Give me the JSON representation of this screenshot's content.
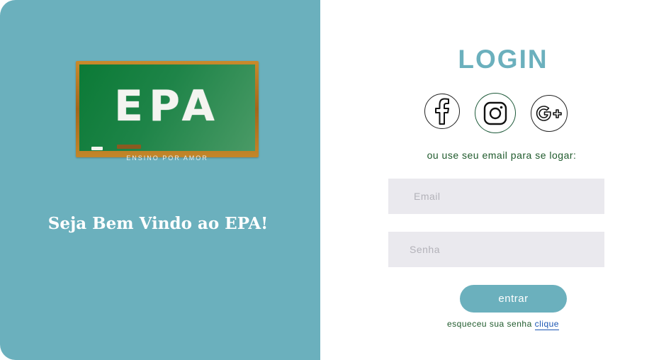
{
  "left": {
    "board_text": "EPA",
    "board_subtitle": "ENSINO POR AMOR",
    "welcome": "Seja Bem Vindo ao EPA!"
  },
  "login": {
    "title": "LOGIN",
    "social_icons": [
      "facebook-icon",
      "instagram-icon",
      "google-plus-icon"
    ],
    "alt_text": "ou use seu email para se logar:",
    "email_placeholder": "Email",
    "password_placeholder": "Senha",
    "submit_label": "entrar",
    "forgot_text": "esqueceu sua senha",
    "forgot_link": "clique"
  },
  "colors": {
    "accent": "#6bb0bd",
    "input_bg": "#eae9ee",
    "text_green": "#1f5a2c",
    "link": "#1a55b3"
  }
}
